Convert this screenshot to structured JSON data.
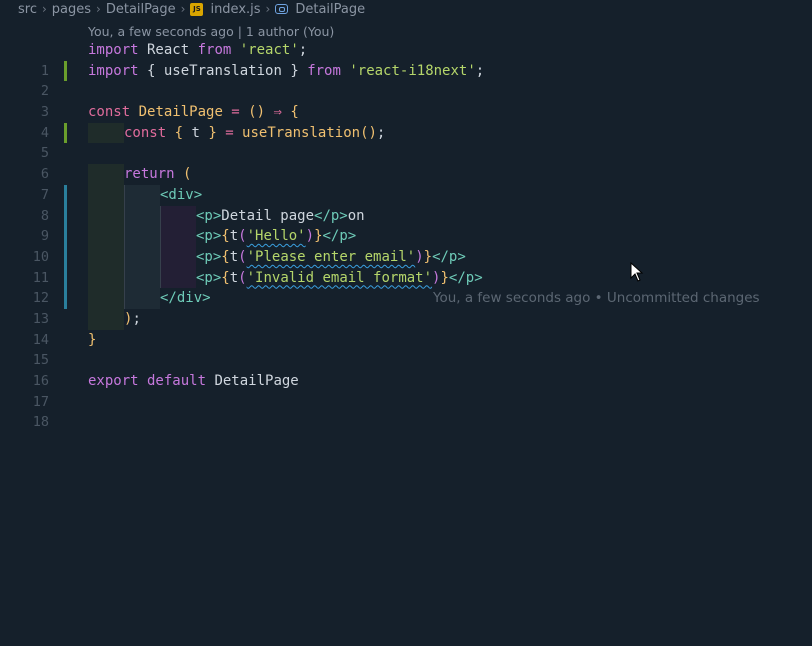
{
  "breadcrumb": {
    "items": [
      "src",
      "pages",
      "DetailPage",
      "index.js",
      "DetailPage"
    ],
    "file_icon_label": "JS"
  },
  "blame_header": "You, a few seconds ago | 1 author (You)",
  "inline_blame": "You, a few seconds ago • Uncommitted changes",
  "line_numbers": [
    "1",
    "2",
    "3",
    "4",
    "5",
    "6",
    "7",
    "8",
    "9",
    "10",
    "11",
    "12",
    "13",
    "14",
    "15",
    "16",
    "17",
    "18"
  ],
  "code": {
    "l1": {
      "kw": "import",
      "name": " React ",
      "from": "from",
      "str": " 'react'",
      "end": ";"
    },
    "l2": {
      "kw": "import",
      "open": " { ",
      "name": "useTranslation",
      "close": " } ",
      "from": "from",
      "str": " 'react-i18next'",
      "end": ";"
    },
    "l4": {
      "kw": "const",
      "name": " DetailPage",
      "eq": " = ",
      "parens": "()",
      "arrow": " ⇒ ",
      "brace": "{"
    },
    "l5": {
      "kw": "const",
      "open": " { ",
      "name": "t",
      "close": " } ",
      "eq": "= ",
      "fn": "useTranslation",
      "call": "()",
      "end": ";"
    },
    "l7": {
      "kw": "return",
      "paren": " ("
    },
    "l8": {
      "tag": "<div>"
    },
    "l9": {
      "tag_open": "<p>",
      "text": "Detail page",
      "tag_close": "</p>",
      "tail": "on"
    },
    "l10": {
      "tag_open": "<p>",
      "brace_open": "{",
      "fn": "t",
      "paren_open": "(",
      "str": "'Hello'",
      "paren_close": ")",
      "brace_close": "}",
      "tag_close": "</p>"
    },
    "l11": {
      "tag_open": "<p>",
      "brace_open": "{",
      "fn": "t",
      "paren_open": "(",
      "str": "'Please enter email'",
      "paren_close": ")",
      "brace_close": "}",
      "tag_close": "</p>"
    },
    "l12": {
      "tag_open": "<p>",
      "brace_open": "{",
      "fn": "t",
      "paren_open": "(",
      "str": "'Invalid email format'",
      "paren_close": ")",
      "brace_close": "}",
      "tag_close": "</p>"
    },
    "l13": {
      "tag": "</div>"
    },
    "l14": {
      "paren": ")",
      "end": ";"
    },
    "l15": {
      "brace": "}"
    },
    "l17": {
      "kw": "export",
      "kw2": " default",
      "name": " DetailPage"
    }
  },
  "colors": {
    "background": "#15202b",
    "keyword": "#c678dd",
    "string": "#b5d66a",
    "tag": "#6ecbb8",
    "gutter_added": "#6a9e2c",
    "gutter_modified": "#2a7f9c"
  }
}
